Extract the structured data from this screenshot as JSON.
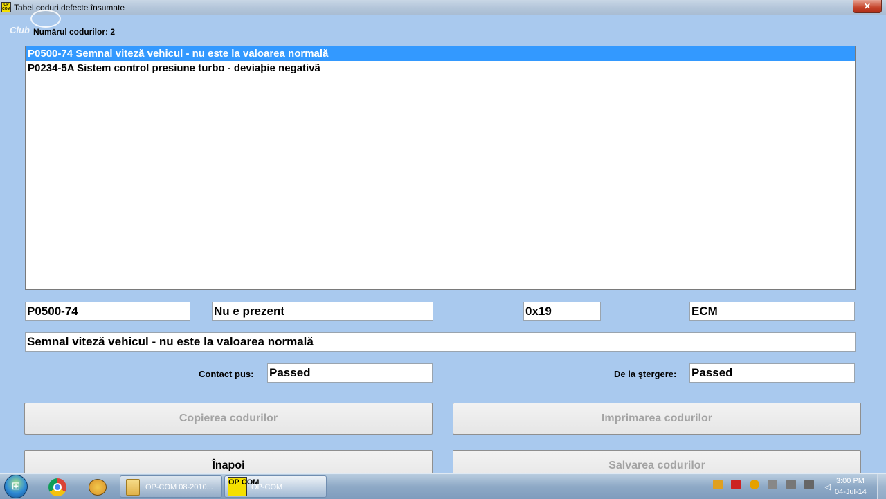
{
  "window": {
    "title": "Tabel  coduri defecte însumate",
    "close_glyph": "✕",
    "app_icon_text": "OP COM",
    "watermark_text": "Club"
  },
  "header": {
    "count_label": "Numărul codurilor: 2"
  },
  "codes_list": [
    {
      "text": "P0500-74 Semnal viteză vehicul - nu este la valoarea normală",
      "selected": true
    },
    {
      "text": "P0234-5A Sistem control presiune turbo - deviaþie negativã",
      "selected": false
    }
  ],
  "details": {
    "code": "P0500-74",
    "status": "Nu e prezent",
    "hex": "0x19",
    "module": "ECM",
    "description": "Semnal viteză vehicul - nu este la valoarea normală",
    "contact_label": "Contact pus:",
    "contact_value": "Passed",
    "erase_label": "De la ştergere:",
    "erase_value": "Passed"
  },
  "buttons": {
    "copy": "Copierea codurilor",
    "print": "Imprimarea codurilor",
    "back": "Înapoi",
    "save": "Salvarea codurilor"
  },
  "taskbar": {
    "start_icon": "start-orb-icon",
    "tasks": [
      {
        "label": "OP-COM 08-2010...",
        "icon": "folder-icon"
      },
      {
        "label": "OP-COM",
        "icon": "opcom-icon",
        "icon_text": "OP COM"
      }
    ],
    "time": "3:00 PM",
    "date": "04-Jul-14"
  },
  "colors": {
    "window_bg": "#a9c9ee",
    "selection": "#3399ff",
    "disabled_text": "#a3a3a3"
  }
}
